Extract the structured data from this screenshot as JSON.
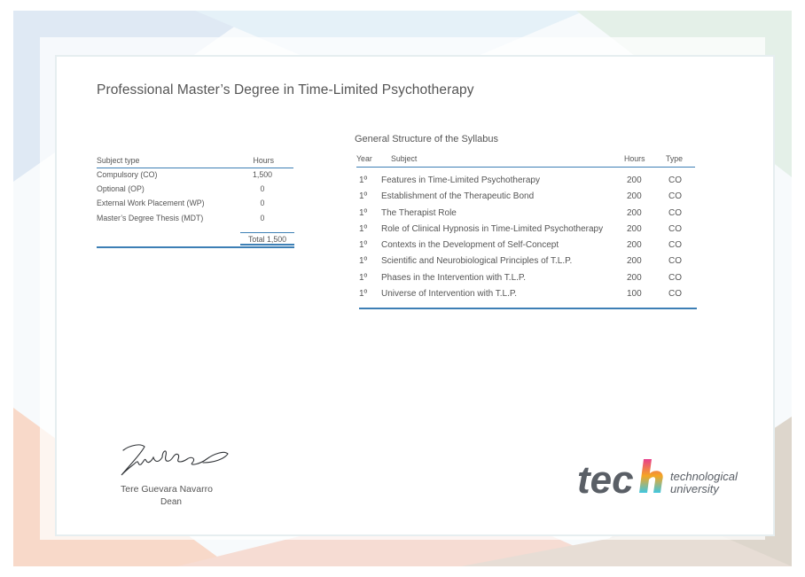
{
  "document": {
    "title": "Professional Master’s Degree in Time-Limited Psychotherapy"
  },
  "summary": {
    "header_type": "Subject type",
    "header_hours": "Hours",
    "rows": [
      {
        "type": "Compulsory (CO)",
        "hours": "1,500"
      },
      {
        "type": "Optional (OP)",
        "hours": "0"
      },
      {
        "type": "External Work Placement (WP)",
        "hours": "0"
      },
      {
        "type": "Master’s Degree Thesis (MDT)",
        "hours": "0"
      }
    ],
    "total": "Total 1,500"
  },
  "syllabus": {
    "title": "General Structure of the Syllabus",
    "headers": {
      "year": "Year",
      "subject": "Subject",
      "hours": "Hours",
      "type": "Type"
    },
    "rows": [
      {
        "year": "1º",
        "subject": "Features in Time-Limited Psychotherapy",
        "hours": "200",
        "type": "CO"
      },
      {
        "year": "1º",
        "subject": "Establishment of the Therapeutic Bond",
        "hours": "200",
        "type": "CO"
      },
      {
        "year": "1º",
        "subject": "The Therapist Role",
        "hours": "200",
        "type": "CO"
      },
      {
        "year": "1º",
        "subject": "Role of Clinical Hypnosis in Time-Limited Psychotherapy",
        "hours": "200",
        "type": "CO"
      },
      {
        "year": "1º",
        "subject": "Contexts in the Development of Self-Concept",
        "hours": "200",
        "type": "CO"
      },
      {
        "year": "1º",
        "subject": "Scientific and Neurobiological Principles of T.L.P.",
        "hours": "200",
        "type": "CO"
      },
      {
        "year": "1º",
        "subject": "Phases in the Intervention with T.L.P.",
        "hours": "200",
        "type": "CO"
      },
      {
        "year": "1º",
        "subject": "Universe of Intervention with T.L.P.",
        "hours": "100",
        "type": "CO"
      }
    ]
  },
  "signatory": {
    "name": "Tere Guevara Navarro",
    "role": "Dean"
  },
  "logo": {
    "brand": "tech",
    "line1": "technological",
    "line2": "university",
    "colors": {
      "text": "#5a5f66",
      "accent_start": "#e83e8c",
      "accent_mid": "#f5a623",
      "accent_end": "#3ec6e0"
    }
  },
  "colors": {
    "rule": "#3d7fb5",
    "text": "#555555"
  }
}
